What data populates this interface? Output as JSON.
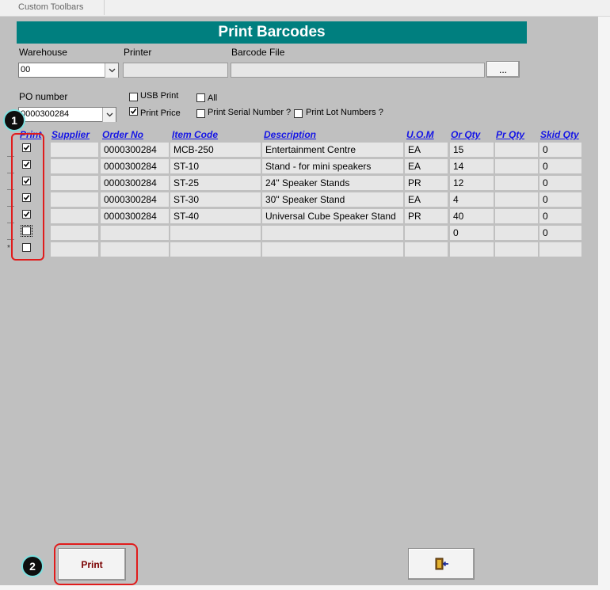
{
  "toolbar": {
    "tab_label": "Custom Toolbars"
  },
  "form": {
    "title": "Print Barcodes",
    "labels": {
      "warehouse": "Warehouse",
      "printer": "Printer",
      "barcode_file": "Barcode File",
      "po_number": "PO number"
    },
    "warehouse_value": "00",
    "po_number_value": "0000300284",
    "browse_button": "...",
    "options": {
      "usb_print": "USB Print",
      "all": "All",
      "print_price": "Print Price",
      "print_serial": "Print Serial Number ?",
      "print_lot": "Print Lot Numbers ?"
    },
    "print_button": "Print",
    "exit_icon": "exit-door-icon"
  },
  "grid": {
    "columns": [
      "Print",
      "Supplier",
      "Order No",
      "Item Code",
      "Description",
      "U.O.M",
      "Or Qty",
      "Pr Qty",
      "Skid Qty"
    ],
    "rows": [
      {
        "order_no": "0000300284",
        "item_code": "MCB-250",
        "description": "Entertainment Centre",
        "uom": "EA",
        "or_qty": "15",
        "skid_qty": "0"
      },
      {
        "order_no": "0000300284",
        "item_code": "ST-10",
        "description": "Stand - for mini speakers",
        "uom": "EA",
        "or_qty": "14",
        "skid_qty": "0"
      },
      {
        "order_no": "0000300284",
        "item_code": "ST-25",
        "description": "24\" Speaker Stands",
        "uom": "PR",
        "or_qty": "12",
        "skid_qty": "0"
      },
      {
        "order_no": "0000300284",
        "item_code": "ST-30",
        "description": "30\" Speaker Stand",
        "uom": "EA",
        "or_qty": "4",
        "skid_qty": "0"
      },
      {
        "order_no": "0000300284",
        "item_code": "ST-40",
        "description": "Universal Cube Speaker Stand",
        "uom": "PR",
        "or_qty": "40",
        "skid_qty": "0"
      },
      {
        "order_no": "",
        "item_code": "",
        "description": "",
        "uom": "",
        "or_qty": "0",
        "skid_qty": "0"
      }
    ],
    "new_row_marker": "*"
  },
  "annotations": {
    "badge1": "1",
    "badge2": "2"
  },
  "colors": {
    "title_bar": "#007f7f",
    "form_bg": "#c0c0c0",
    "header_link": "#1515e6",
    "annotation": "#e01c1c"
  }
}
